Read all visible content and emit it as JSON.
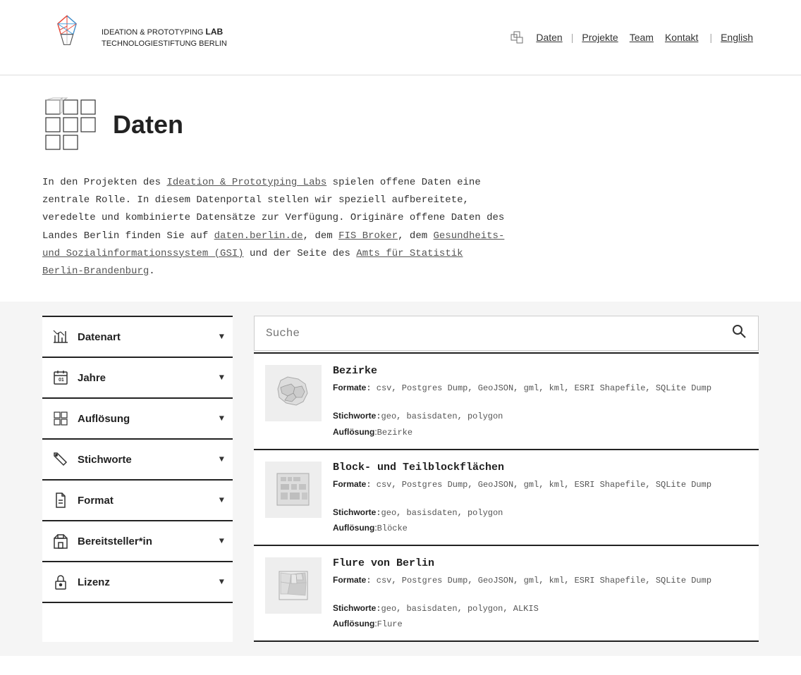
{
  "header": {
    "logo_line1": "IDEATION & PROTOTYPING",
    "logo_lab": "LAB",
    "logo_line2": "TECHNOLOGIESTIFTUNG BERLIN",
    "nav_icon_alt": "data-icon",
    "nav_items": [
      {
        "label": "Daten",
        "href": "#",
        "active": true
      },
      {
        "label": "Projekte",
        "href": "#"
      },
      {
        "label": "Team",
        "href": "#"
      },
      {
        "label": "Kontakt",
        "href": "#"
      },
      {
        "label": "English",
        "href": "#"
      }
    ]
  },
  "hero": {
    "title": "Daten",
    "icon_alt": "daten-icon"
  },
  "intro": {
    "text_parts": [
      {
        "type": "text",
        "content": "In den Projekten des "
      },
      {
        "type": "link",
        "content": "Ideation & Prototyping Labs",
        "href": "#"
      },
      {
        "type": "text",
        "content": " spielen offene Daten eine zentrale Rolle. In diesem Datenportal stellen wir speziell aufbereitete, veredelte und kombinierte Datensätze zur Verfügung. Originäre offene Daten des Landes Berlin finden Sie auf "
      },
      {
        "type": "link",
        "content": "daten.berlin.de",
        "href": "#"
      },
      {
        "type": "text",
        "content": ", dem "
      },
      {
        "type": "link",
        "content": "FIS Broker",
        "href": "#"
      },
      {
        "type": "text",
        "content": ", dem "
      },
      {
        "type": "link",
        "content": "Gesundheits- und Sozialinformationssystem (GSI)",
        "href": "#"
      },
      {
        "type": "text",
        "content": " und der Seite des "
      },
      {
        "type": "link",
        "content": "Amts für Statistik Berlin-Brandenburg",
        "href": "#"
      },
      {
        "type": "text",
        "content": "."
      }
    ]
  },
  "sidebar": {
    "filters": [
      {
        "id": "datenart",
        "label": "Datenart",
        "icon": "chart-icon"
      },
      {
        "id": "jahre",
        "label": "Jahre",
        "icon": "calendar-icon"
      },
      {
        "id": "aufloesung",
        "label": "Auflösung",
        "icon": "grid-icon"
      },
      {
        "id": "stichworte",
        "label": "Stichworte",
        "icon": "tag-icon"
      },
      {
        "id": "format",
        "label": "Format",
        "icon": "doc-icon"
      },
      {
        "id": "bereitsteller",
        "label": "Bereitsteller*in",
        "icon": "building-icon"
      },
      {
        "id": "lizenz",
        "label": "Lizenz",
        "icon": "lock-icon"
      }
    ]
  },
  "search": {
    "placeholder": "Suche",
    "button_label": "🔍"
  },
  "cards": [
    {
      "id": "bezirke",
      "title": "Bezirke",
      "formate": "csv, Postgres Dump, GeoJSON, gml, kml, ESRI Shapefile, SQLite Dump",
      "stichworte": "geo, basisdaten, polygon",
      "aufloesung": "Bezirke"
    },
    {
      "id": "block-teilblock",
      "title": "Block- und Teilblockflächen",
      "formate": "csv, Postgres Dump, GeoJSON, gml, kml, ESRI Shapefile, SQLite Dump",
      "stichworte": "geo, basisdaten, polygon",
      "aufloesung": "Blöcke"
    },
    {
      "id": "flure",
      "title": "Flure von Berlin",
      "formate": "csv, Postgres Dump, GeoJSON, gml, kml, ESRI Shapefile, SQLite Dump",
      "stichworte": "geo, basisdaten, polygon, ALKIS",
      "aufloesung": "Flure"
    }
  ],
  "labels": {
    "formate": "Formate",
    "stichworte": "Stichworte",
    "aufloesung": "Auflösung"
  }
}
